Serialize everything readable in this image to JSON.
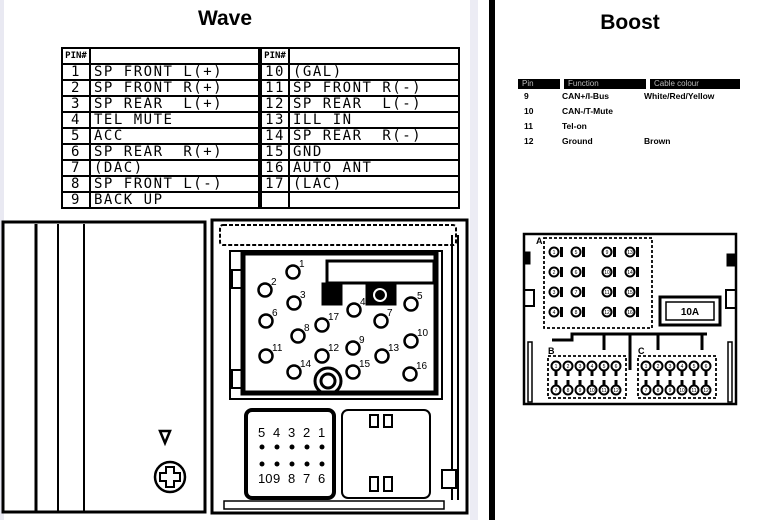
{
  "wave": {
    "title": "Wave",
    "table_header": "PIN#",
    "pins_left": [
      {
        "pin": "1",
        "function": "SP FRONT L(+)"
      },
      {
        "pin": "2",
        "function": "SP FRONT R(+)"
      },
      {
        "pin": "3",
        "function": "SP REAR  L(+)"
      },
      {
        "pin": "4",
        "function": "TEL MUTE"
      },
      {
        "pin": "5",
        "function": "ACC"
      },
      {
        "pin": "6",
        "function": "SP REAR  R(+)"
      },
      {
        "pin": "7",
        "function": "(DAC)"
      },
      {
        "pin": "8",
        "function": "SP FRONT L(-)"
      },
      {
        "pin": "9",
        "function": "BACK UP"
      }
    ],
    "pins_right": [
      {
        "pin": "10",
        "function": "(GAL)"
      },
      {
        "pin": "11",
        "function": "SP FRONT R(-)"
      },
      {
        "pin": "12",
        "function": "SP REAR  L(-)"
      },
      {
        "pin": "13",
        "function": "ILL IN"
      },
      {
        "pin": "14",
        "function": "SP REAR  R(-)"
      },
      {
        "pin": "15",
        "function": "GND"
      },
      {
        "pin": "16",
        "function": "AUTO ANT"
      },
      {
        "pin": "17",
        "function": "(LAC)"
      },
      {
        "pin": "",
        "function": ""
      }
    ],
    "connector_pin_labels": [
      "1",
      "2",
      "3",
      "4",
      "5",
      "6",
      "7",
      "8",
      "9",
      "10",
      "11",
      "12",
      "13",
      "14",
      "15",
      "16",
      "17"
    ],
    "small_connector_top": [
      "5",
      "4",
      "3",
      "2",
      "1"
    ],
    "small_connector_bottom": [
      "10",
      "9",
      "8",
      "7",
      "6"
    ]
  },
  "boost": {
    "title": "Boost",
    "headers": [
      "Pin",
      "Function",
      "Cable colour"
    ],
    "rows": [
      {
        "pin": "9",
        "function": "CAN+/I-Bus",
        "colour": "White/Red/Yellow"
      },
      {
        "pin": "10",
        "function": "CAN-/T-Mute",
        "colour": ""
      },
      {
        "pin": "11",
        "function": "Tel-on",
        "colour": ""
      },
      {
        "pin": "12",
        "function": "Ground",
        "colour": "Brown"
      }
    ],
    "block_labels": [
      "A",
      "B",
      "C"
    ],
    "fuse_label": "10A",
    "block_a_pins": [
      "1",
      "5",
      "9",
      "13",
      "2",
      "6",
      "10",
      "14",
      "3",
      "7",
      "11",
      "15",
      "4",
      "8",
      "12",
      "16"
    ],
    "block_b_top": [
      "1",
      "2",
      "3",
      "4",
      "5",
      "6"
    ],
    "block_b_bottom": [
      "7",
      "8",
      "9",
      "10",
      "11",
      "12"
    ],
    "block_c_top": [
      "1",
      "2",
      "3",
      "4",
      "5",
      "6"
    ],
    "block_c_bottom": [
      "7",
      "8",
      "9",
      "10",
      "11",
      "12"
    ]
  }
}
